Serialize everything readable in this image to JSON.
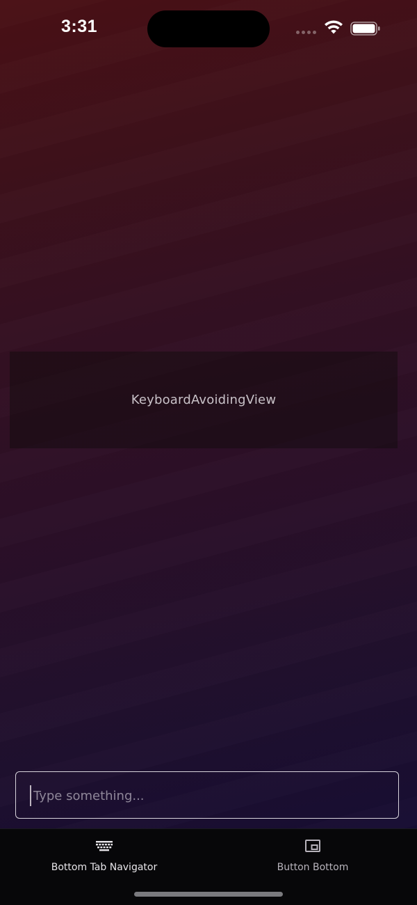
{
  "status_bar": {
    "time": "3:31",
    "icons": [
      "signal-dots-icon",
      "wifi-icon",
      "battery-icon"
    ]
  },
  "main": {
    "kav_label": "KeyboardAvoidingView"
  },
  "input": {
    "value": "",
    "placeholder": "Type something..."
  },
  "tabs": [
    {
      "label": "Bottom Tab Navigator",
      "icon": "keyboard-icon",
      "active": true
    },
    {
      "label": "Button Bottom",
      "icon": "picture-in-picture-icon",
      "active": false
    }
  ],
  "colors": {
    "background_top": "#4a1015",
    "background_bottom": "#120c33",
    "tab_bar": "#070709",
    "input_border": "#d8d4dc",
    "placeholder": "#8f8799"
  }
}
